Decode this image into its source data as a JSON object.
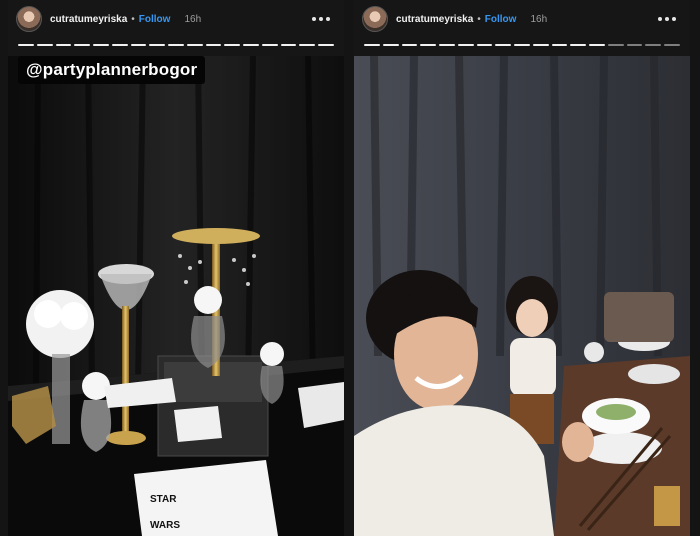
{
  "stories": [
    {
      "username": "cutratumeyriska",
      "separator": "•",
      "follow_label": "Follow",
      "time": "16h",
      "segments_total": 17,
      "segments_seen": 17,
      "mention_sticker": "@partyplannerbogor",
      "card_text": "STAR\nWARS"
    },
    {
      "username": "cutratumeyriska",
      "separator": "•",
      "follow_label": "Follow",
      "time": "16h",
      "segments_total": 17,
      "segments_seen": 13
    }
  ],
  "colors": {
    "follow": "#3897f0",
    "background": "#141414"
  }
}
